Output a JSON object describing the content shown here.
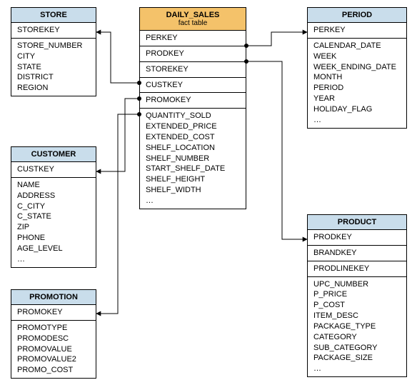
{
  "store": {
    "title": "STORE",
    "key": "STOREKEY",
    "fields": "STORE_NUMBER\nCITY\nSTATE\nDISTRICT\nREGION"
  },
  "customer": {
    "title": "CUSTOMER",
    "key": "CUSTKEY",
    "fields": "NAME\nADDRESS\nC_CITY\nC_STATE\nZIP\nPHONE\nAGE_LEVEL\n…"
  },
  "promotion": {
    "title": "PROMOTION",
    "key": "PROMOKEY",
    "fields": "PROMOTYPE\nPROMODESC\nPROMOVALUE\nPROMOVALUE2\nPROMO_COST"
  },
  "daily_sales": {
    "title": "DAILY_SALES",
    "subtitle": "fact table",
    "fk1": "PERKEY",
    "fk2": "PRODKEY",
    "fk3": "STOREKEY",
    "fk4": "CUSTKEY",
    "fk5": "PROMOKEY",
    "fields": "QUANTITY_SOLD\nEXTENDED_PRICE\nEXTENDED_COST\nSHELF_LOCATION\nSHELF_NUMBER\nSTART_SHELF_DATE\nSHELF_HEIGHT\nSHELF_WIDTH\n…"
  },
  "period": {
    "title": "PERIOD",
    "key": "PERKEY",
    "fields": "CALENDAR_DATE\nWEEK\nWEEK_ENDING_DATE\nMONTH\nPERIOD\nYEAR\nHOLIDAY_FLAG\n…"
  },
  "product": {
    "title": "PRODUCT",
    "key1": "PRODKEY",
    "key2": "BRANDKEY",
    "key3": "PRODLINEKEY",
    "fields": "UPC_NUMBER\nP_PRICE\nP_COST\nITEM_DESC\nPACKAGE_TYPE\nCATEGORY\nSUB_CATEGORY\nPACKAGE_SIZE\n…"
  }
}
